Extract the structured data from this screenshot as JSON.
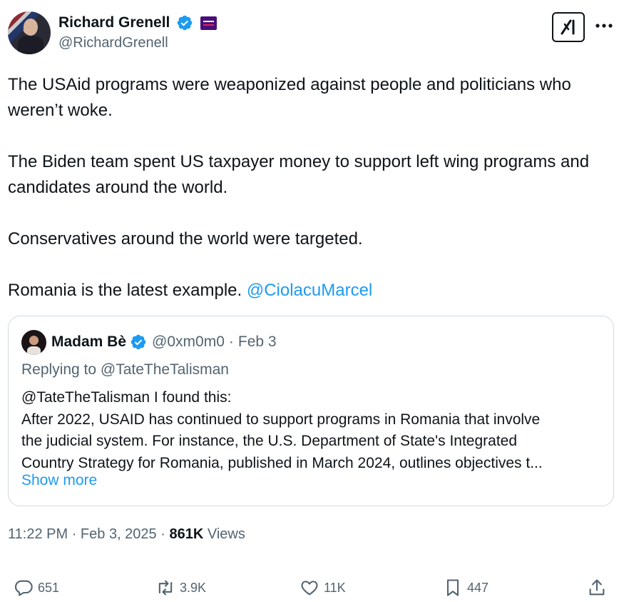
{
  "author": {
    "display_name": "Richard Grenell",
    "handle": "@RichardGrenell",
    "avatar_icon": "profile-photo",
    "verified_icon": "verified-badge-icon",
    "affiliation_icon": "cpac-badge-icon"
  },
  "header": {
    "grok_icon": "grok-icon",
    "more_icon": "more-icon"
  },
  "tweet": {
    "paragraphs": [
      "The USAid programs were weaponized against people and politicians who weren’t woke.",
      "The Biden team spent US taxpayer money to support left wing programs and candidates around the world.",
      "Conservatives around the world were targeted."
    ],
    "last_line_text": "Romania is the latest example.",
    "last_line_mention": "@CiolacuMarcel"
  },
  "quote": {
    "display_name": "Madam Bè",
    "handle": "@0xm0m0",
    "separator": "·",
    "date": "Feb 3",
    "replying_to": "Replying to @TateTheTalisman",
    "body_lines": [
      "@TateTheTalisman I found this:",
      "After 2022, USAID has continued to support programs in Romania that involve",
      "the judicial system. For instance, the U.S. Department of State's Integrated",
      "Country Strategy for Romania, published in March 2024, outlines objectives t..."
    ],
    "show_more": "Show more"
  },
  "meta": {
    "time": "11:22 PM",
    "separator": "·",
    "date": "Feb 3, 2025",
    "views_count": "861K",
    "views_label": "Views"
  },
  "actions": {
    "replies": "651",
    "reposts": "3.9K",
    "likes": "11K",
    "bookmarks": "447"
  },
  "colors": {
    "link": "#1d9bf0",
    "secondary_text": "#536471",
    "primary_text": "#0f1419",
    "border": "#cfd9de"
  }
}
